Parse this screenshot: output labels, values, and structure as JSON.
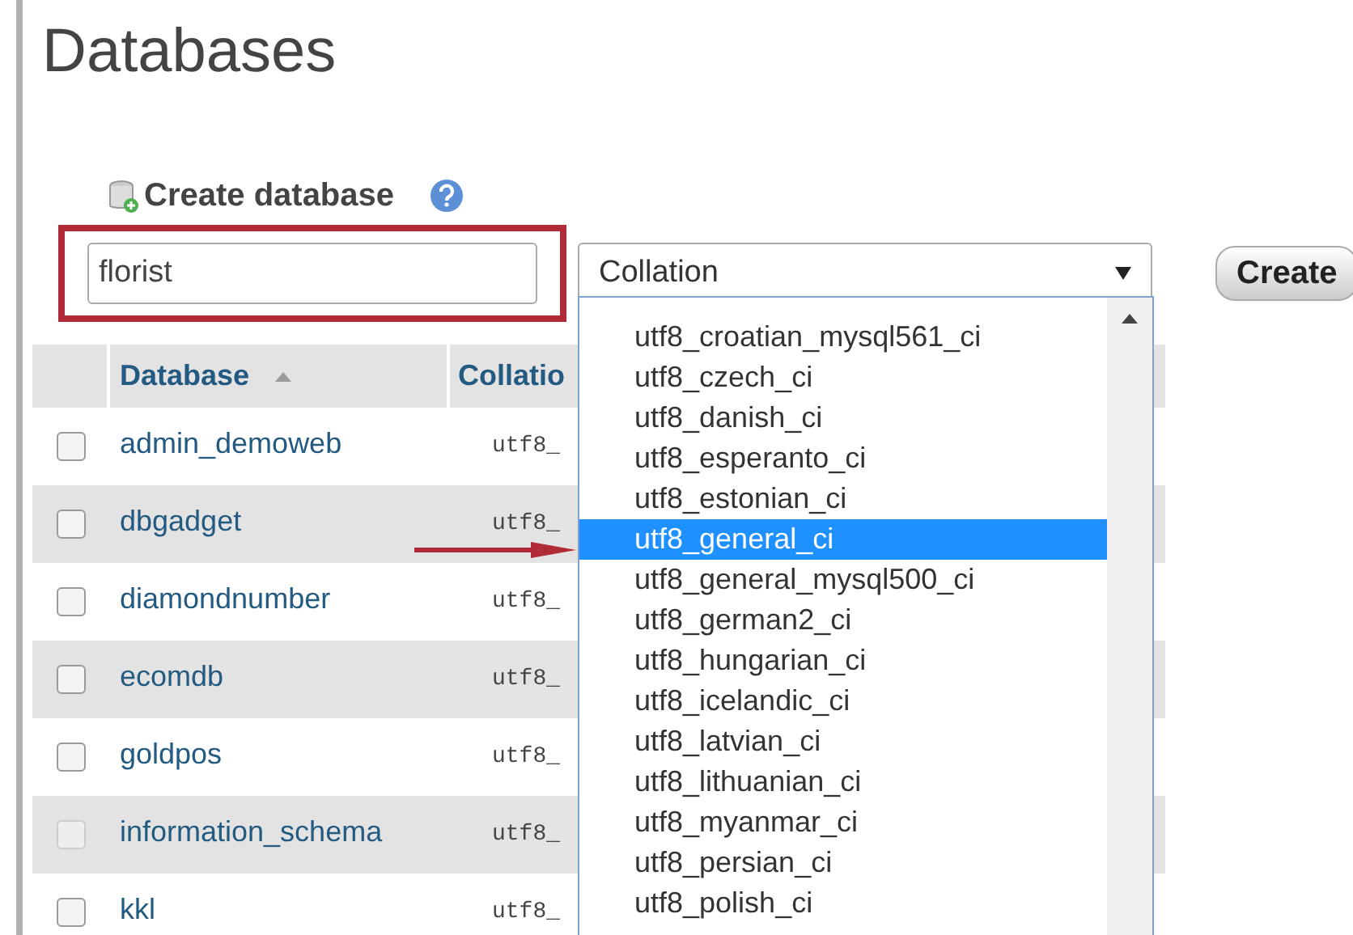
{
  "title": "Databases",
  "create": {
    "label": "Create database",
    "name_field": {
      "value": "florist"
    },
    "collation_select": {
      "value": "Collation",
      "options": [
        {
          "label": "utf8_croatian_mysql561_ci",
          "selected": false
        },
        {
          "label": "utf8_czech_ci",
          "selected": false
        },
        {
          "label": "utf8_danish_ci",
          "selected": false
        },
        {
          "label": "utf8_esperanto_ci",
          "selected": false
        },
        {
          "label": "utf8_estonian_ci",
          "selected": false
        },
        {
          "label": "utf8_general_ci",
          "selected": true
        },
        {
          "label": "utf8_general_mysql500_ci",
          "selected": false
        },
        {
          "label": "utf8_german2_ci",
          "selected": false
        },
        {
          "label": "utf8_hungarian_ci",
          "selected": false
        },
        {
          "label": "utf8_icelandic_ci",
          "selected": false
        },
        {
          "label": "utf8_latvian_ci",
          "selected": false
        },
        {
          "label": "utf8_lithuanian_ci",
          "selected": false
        },
        {
          "label": "utf8_myanmar_ci",
          "selected": false
        },
        {
          "label": "utf8_persian_ci",
          "selected": false
        },
        {
          "label": "utf8_polish_ci",
          "selected": false
        }
      ]
    },
    "button": "Create"
  },
  "table": {
    "columns": [
      "Database",
      "Collatio"
    ],
    "rows": [
      {
        "name": "admin_demoweb",
        "collation": "utf8_",
        "checked": false,
        "disabled": false
      },
      {
        "name": "dbgadget",
        "collation": "utf8_",
        "checked": false,
        "disabled": false
      },
      {
        "name": "diamondnumber",
        "collation": "utf8_",
        "checked": false,
        "disabled": false
      },
      {
        "name": "ecomdb",
        "collation": "utf8_",
        "checked": false,
        "disabled": false
      },
      {
        "name": "goldpos",
        "collation": "utf8_",
        "checked": false,
        "disabled": false
      },
      {
        "name": "information_schema",
        "collation": "utf8_",
        "checked": false,
        "disabled": true
      },
      {
        "name": "kkl",
        "collation": "utf8_",
        "checked": false,
        "disabled": false
      }
    ]
  }
}
